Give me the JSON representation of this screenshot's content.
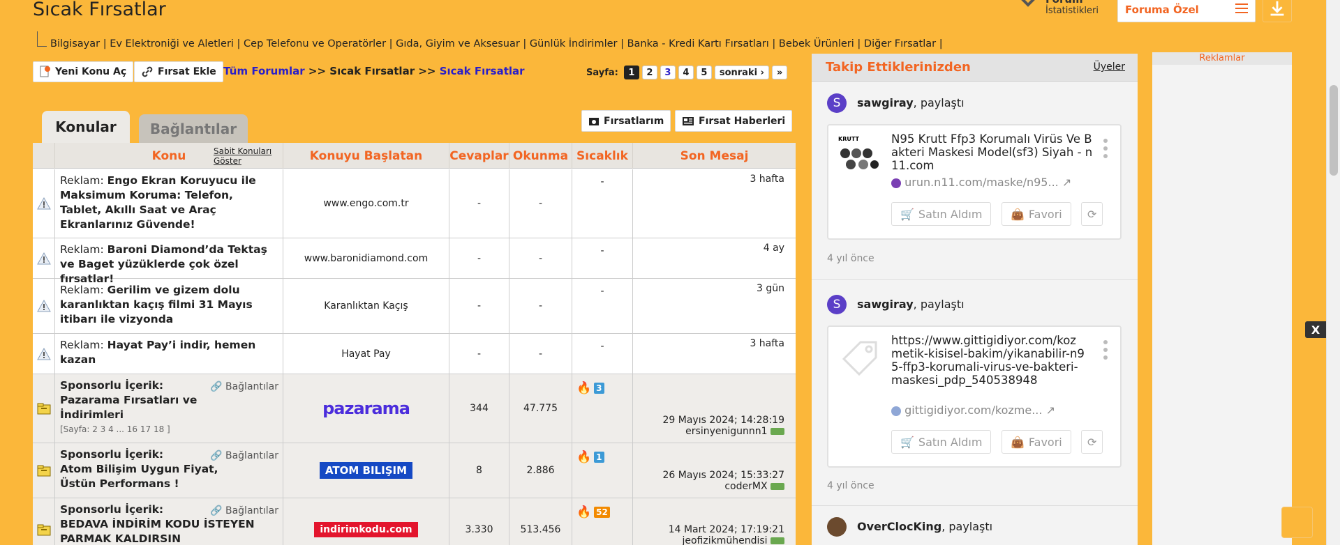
{
  "header": {
    "title": "Sıcak Fırsatlar",
    "forum_stats_title": "Forum",
    "forum_stats_sub": "İstatistikleri",
    "special_button": "Foruma Özel"
  },
  "categories": "Bilgisayar | Ev Elektroniği ve Aletleri | Cep Telefonu ve Operatörler | Gıda, Giyim ve Aksesuar | Günlük İndirimler | Banka - Kredi Kartı Fırsatları | Bebek Ürünleri | Diğer Fırsatlar |",
  "toolbar": {
    "new_topic": "Yeni Konu Aç",
    "add_deal": "Fırsat Ekle",
    "crumb_all": "Tüm Forumlar",
    "crumb_sep1": ">>",
    "crumb_mid": "Sıcak Fırsatlar",
    "crumb_sep2": ">>",
    "crumb_current": "Sıcak Fırsatlar",
    "page_label": "Sayfa:",
    "pages": [
      "1",
      "2",
      "3",
      "4",
      "5"
    ],
    "next": "sonraki"
  },
  "tabs": {
    "topics": "Konular",
    "links": "Bağlantılar"
  },
  "actions": {
    "my_deals": "Fırsatlarım",
    "deal_news": "Fırsat Haberleri"
  },
  "table": {
    "headers": {
      "topic": "Konu",
      "sticky": "Sabit Konuları Göster",
      "starter": "Konuyu Başlatan",
      "replies": "Cevaplar",
      "views": "Okunma",
      "heat": "Sıcaklık",
      "last": "Son Mesaj"
    },
    "ad_rows": [
      {
        "prefix": "Reklam:",
        "title": "Engo Ekran Koruyucu ile Maksimum Koruma: Telefon, Tablet, Akıllı Saat ve Araç Ekranlarınız Güvende!",
        "starter": "www.engo.com.tr",
        "replies": "-",
        "views": "-",
        "heat": "-",
        "last": "3 hafta"
      },
      {
        "prefix": "Reklam:",
        "title": "Baroni Diamond’da Tektaş ve Baget yüzüklerde çok özel fırsatlar!",
        "starter": "www.baronidiamond.com",
        "replies": "-",
        "views": "-",
        "heat": "-",
        "last": "4 ay"
      },
      {
        "prefix": "Reklam:",
        "title": "Gerilim ve gizem dolu karanlıktan kaçış filmi 31 Mayıs itibarı ile vizyonda",
        "starter": "Karanlıktan Kaçış",
        "replies": "-",
        "views": "-",
        "heat": "-",
        "last": "3 gün"
      },
      {
        "prefix": "Reklam:",
        "title": "Hayat Pay’i indir, hemen kazan",
        "starter": "Hayat Pay",
        "replies": "-",
        "views": "-",
        "heat": "-",
        "last": "3 hafta"
      }
    ],
    "sponsored_rows": [
      {
        "prefix": "Sponsorlu İçerik:",
        "title": "Pazarama Fırsatları ve İndirimleri",
        "pages": "[Sayfa: 2 3 4 ... 16 17 18 ]",
        "links": "Bağlantılar",
        "logo": "pazarama",
        "replies": "344",
        "views": "47.775",
        "heat": "3",
        "heat_color": "#3c9ad6",
        "date": "29 Mayıs 2024; 14:28:19",
        "user": "ersinyenigunnn1"
      },
      {
        "prefix": "Sponsorlu İçerik:",
        "title": "Atom Bilişim Uygun Fiyat, Üstün Performans !",
        "pages": "",
        "links": "Bağlantılar",
        "logo": "ATOM BILIŞIM",
        "replies": "8",
        "views": "2.886",
        "heat": "1",
        "heat_color": "#3c9ad6",
        "date": "26 Mayıs 2024; 15:33:27",
        "user": "coderMX"
      },
      {
        "prefix": "Sponsorlu İçerik:",
        "title": "BEDAVA İNDİRİM KODU İSTEYEN PARMAK KALDIRSIN",
        "pages": "",
        "links": "Bağlantılar",
        "logo": "indirimkodu.com",
        "replies": "3.330",
        "views": "513.456",
        "heat": "52",
        "heat_color": "#f28a00",
        "date": "14 Mart 2024; 17:19:21",
        "user": "jeofizikmühendisi"
      }
    ]
  },
  "sidebar": {
    "title": "Takip Ettiklerinizden",
    "members_link": "Üyeler",
    "items": [
      {
        "avatar": "S",
        "user": "sawgiray",
        "action": ", paylaştı",
        "title": "N95 Krutt Ffp3 Korumalı Virüs Ve Bakteri Maskesi Model(sf3) Siyah - n11.com",
        "domain": "urun.n11.com/maske/n95...",
        "buy": "Satın Aldım",
        "fav": "Favori",
        "ago": "4 yıl önce"
      },
      {
        "avatar": "S",
        "user": "sawgiray",
        "action": ", paylaştı",
        "title": "https://www.gittigidiyor.com/kozmetik-kisisel-bakim/yikanabilir-n95-ffp3-korumali-virus-ve-bakteri-maskesi_pdp_540538948",
        "domain": "gittigidiyor.com/kozme...",
        "buy": "Satın Aldım",
        "fav": "Favori",
        "ago": "4 yıl önce"
      },
      {
        "avatar": "",
        "user": "OverClocKing",
        "action": ", paylaştı"
      }
    ]
  },
  "ads": {
    "title": "Reklamlar"
  },
  "overlay": {
    "close": "X"
  },
  "colors": {
    "background": "#fbb73a",
    "accent": "#f26522",
    "link": "#2a1fc9"
  }
}
